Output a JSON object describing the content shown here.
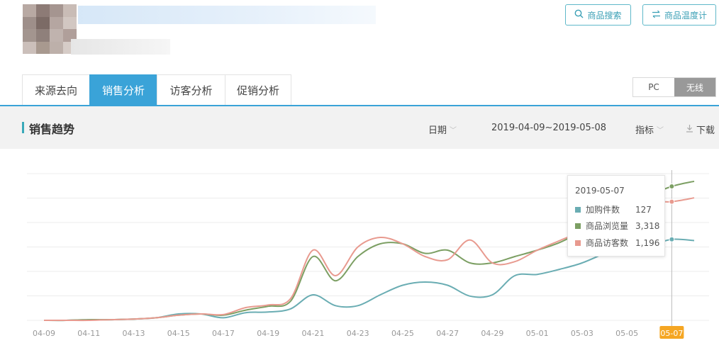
{
  "header": {
    "product_search_label": "商品搜索",
    "product_temperature_label": "商品温度计",
    "search_icon": "search-icon",
    "swap_icon": "swap-icon"
  },
  "tabs": [
    {
      "label": "来源去向",
      "active": false
    },
    {
      "label": "销售分析",
      "active": true
    },
    {
      "label": "访客分析",
      "active": false
    },
    {
      "label": "促销分析",
      "active": false
    }
  ],
  "device_toggle": {
    "pc": "PC",
    "wireless": "无线",
    "selected": "无线"
  },
  "section": {
    "title": "销售趋势",
    "date_label": "日期",
    "date_range": "2019-04-09~2019-05-08",
    "metric_label": "指标",
    "download_label": "下载"
  },
  "colors": {
    "accent": "#3aa3d8",
    "teal": "#6aadb3",
    "green": "#7c9f63",
    "pink": "#e89a8f"
  },
  "chart_data": {
    "type": "line",
    "x": [
      "04-09",
      "04-10",
      "04-11",
      "04-12",
      "04-13",
      "04-14",
      "04-15",
      "04-16",
      "04-17",
      "04-18",
      "04-19",
      "04-20",
      "04-21",
      "04-22",
      "04-23",
      "04-24",
      "04-25",
      "04-26",
      "04-27",
      "04-28",
      "04-29",
      "04-30",
      "05-01",
      "05-02",
      "05-03",
      "05-04",
      "05-05",
      "05-06",
      "05-07",
      "05-08"
    ],
    "xticks": [
      "04-09",
      "04-11",
      "04-13",
      "04-15",
      "04-17",
      "04-19",
      "04-21",
      "04-23",
      "04-25",
      "04-27",
      "04-29",
      "05-01",
      "05-03",
      "05-05",
      "05-07"
    ],
    "highlight_x": "05-07",
    "grid": true,
    "y_axis_labels_visible": false,
    "series": [
      {
        "name": "加购件数",
        "color": "#6aadb3",
        "values": [
          0,
          0,
          1,
          1,
          2,
          4,
          10,
          10,
          4,
          12,
          13,
          18,
          40,
          23,
          23,
          40,
          55,
          60,
          55,
          38,
          40,
          70,
          72,
          80,
          90,
          105,
          120,
          118,
          127,
          125
        ]
      },
      {
        "name": "商品浏览量",
        "color": "#7c9f63",
        "values": [
          0,
          0,
          1,
          1,
          2,
          4,
          8,
          10,
          8,
          16,
          22,
          30,
          100,
          62,
          100,
          120,
          120,
          105,
          110,
          90,
          90,
          100,
          110,
          122,
          140,
          160,
          175,
          195,
          210,
          218
        ]
      },
      {
        "name": "商品访客数",
        "color": "#e89a8f",
        "values": [
          0,
          0,
          0,
          1,
          2,
          4,
          8,
          10,
          9,
          20,
          24,
          34,
          110,
          70,
          115,
          130,
          120,
          100,
          95,
          126,
          90,
          92,
          110,
          125,
          140,
          160,
          170,
          185,
          186,
          192
        ]
      }
    ],
    "tooltip": {
      "date": "2019-05-07",
      "items": [
        {
          "name": "加购件数",
          "value": "127"
        },
        {
          "name": "商品浏览量",
          "value": "3,318"
        },
        {
          "name": "商品访客数",
          "value": "1,196"
        }
      ]
    }
  }
}
